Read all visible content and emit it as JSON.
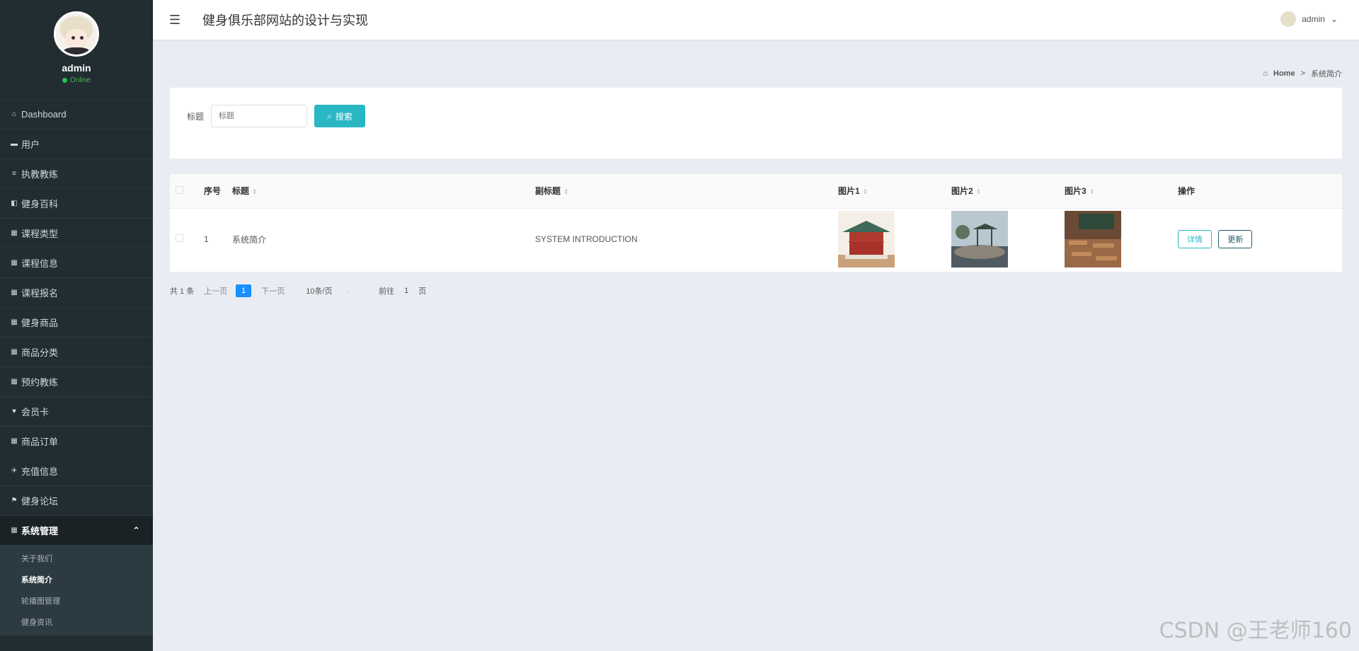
{
  "profile": {
    "name": "admin",
    "status": "Online"
  },
  "sidebar": {
    "items": [
      {
        "icon": "⌂",
        "label": "Dashboard"
      },
      {
        "icon": "▬",
        "label": "用户"
      },
      {
        "icon": "≡",
        "label": "执教教练"
      },
      {
        "icon": "◧",
        "label": "健身百科"
      },
      {
        "icon": "▦",
        "label": "课程类型"
      },
      {
        "icon": "▦",
        "label": "课程信息"
      },
      {
        "icon": "▦",
        "label": "课程报名"
      },
      {
        "icon": "▦",
        "label": "健身商品"
      },
      {
        "icon": "▦",
        "label": "商品分类"
      },
      {
        "icon": "▦",
        "label": "预约教练"
      },
      {
        "icon": "♥",
        "label": "会员卡"
      },
      {
        "icon": "▦",
        "label": "商品订单"
      },
      {
        "icon": "✈",
        "label": "充值信息"
      },
      {
        "icon": "⚑",
        "label": "健身论坛"
      }
    ],
    "active": {
      "icon": "▦",
      "label": "系统管理"
    },
    "subitems": [
      "关于我们",
      "系统简介",
      "轮播图管理",
      "健身资讯"
    ]
  },
  "header": {
    "title": "健身俱乐部网站的设计与实现",
    "user": "admin"
  },
  "breadcrumb": {
    "home": "Home",
    "sep": ">",
    "current": "系统简介"
  },
  "search": {
    "label": "标题",
    "placeholder": "标题",
    "button": "搜索"
  },
  "table": {
    "headers": [
      "序号",
      "标题",
      "副标题",
      "图片1",
      "图片2",
      "图片3",
      "操作"
    ],
    "row": {
      "index": "1",
      "title": "系统简介",
      "subtitle": "SYSTEM INTRODUCTION"
    },
    "actions": {
      "detail": "详情",
      "update": "更新"
    }
  },
  "pagination": {
    "total": "共 1 条",
    "prev": "上一页",
    "page": "1",
    "next": "下一页",
    "size": "10条/页",
    "goto": "前往",
    "goto_page": "1",
    "goto_suffix": "页"
  },
  "watermark": "CSDN @王老师160"
}
